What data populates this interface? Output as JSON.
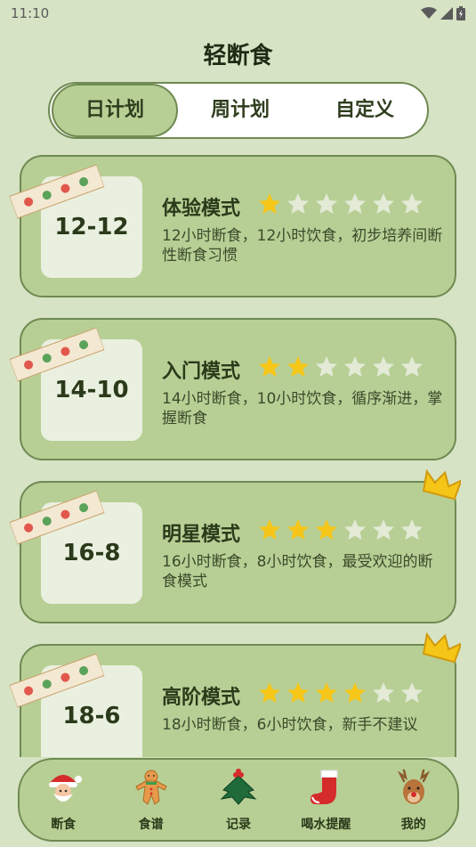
{
  "status_bar": {
    "time": "11:10"
  },
  "app_title": "轻断食",
  "tabs": [
    {
      "label": "日计划",
      "active": true
    },
    {
      "label": "周计划",
      "active": false
    },
    {
      "label": "自定义",
      "active": false
    }
  ],
  "plans": [
    {
      "code": "12-12",
      "name": "体验模式",
      "stars_filled": 1,
      "stars_total": 6,
      "desc": "12小时断食，12小时饮食，初步培养间断性断食习惯",
      "crown": false
    },
    {
      "code": "14-10",
      "name": "入门模式",
      "stars_filled": 2,
      "stars_total": 6,
      "desc": "14小时断食，10小时饮食，循序渐进，掌握断食",
      "crown": false
    },
    {
      "code": "16-8",
      "name": "明星模式",
      "stars_filled": 3,
      "stars_total": 6,
      "desc": "16小时断食，8小时饮食，最受欢迎的断食模式",
      "crown": true
    },
    {
      "code": "18-6",
      "name": "高阶模式",
      "stars_filled": 4,
      "stars_total": 6,
      "desc": "18小时断食，6小时饮食，新手不建议",
      "crown": true
    }
  ],
  "bottom_nav": [
    {
      "label": "断食",
      "icon": "santa-icon"
    },
    {
      "label": "食谱",
      "icon": "gingerbread-icon"
    },
    {
      "label": "记录",
      "icon": "holly-icon"
    },
    {
      "label": "喝水提醒",
      "icon": "stocking-icon"
    },
    {
      "label": "我的",
      "icon": "reindeer-icon"
    }
  ],
  "colors": {
    "background": "#d6e3c4",
    "card": "#b7cf95",
    "border": "#6f8a52",
    "star_filled": "#f5c518",
    "star_empty": "#e3ead6"
  }
}
